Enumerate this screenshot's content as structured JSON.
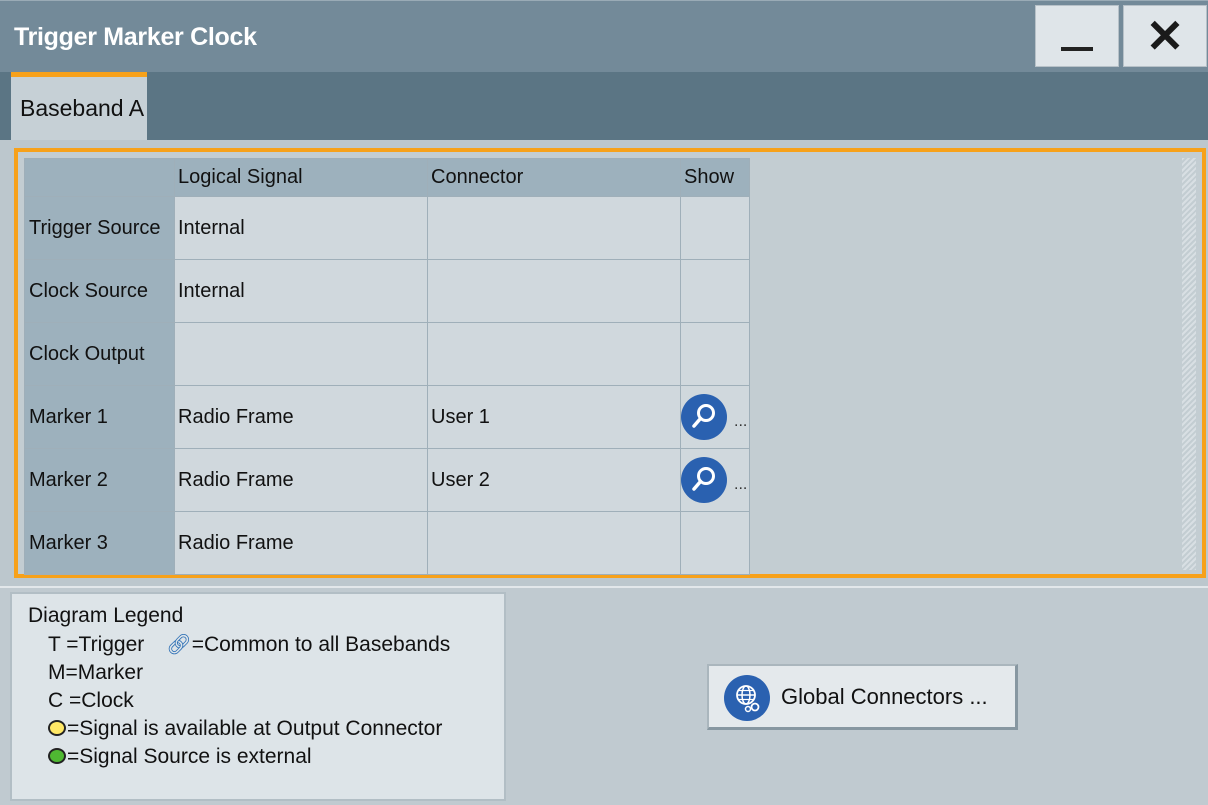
{
  "window": {
    "title": "Trigger Marker Clock",
    "minimize_label": "—",
    "close_label": "✕"
  },
  "tabs": [
    {
      "label": "Baseband A",
      "active": true
    }
  ],
  "table": {
    "headers": [
      "",
      "Logical Signal",
      "Connector",
      "Show"
    ],
    "rows": [
      {
        "label": "Trigger Source",
        "signal": "Internal",
        "connector": "",
        "show": false
      },
      {
        "label": "Clock Source",
        "signal": "Internal",
        "connector": "",
        "show": false
      },
      {
        "label": "Clock Output",
        "signal": "",
        "connector": "",
        "show": false
      },
      {
        "label": "Marker 1",
        "signal": "Radio Frame",
        "connector": "User 1",
        "show": true,
        "show_suffix": "..."
      },
      {
        "label": "Marker 2",
        "signal": "Radio Frame",
        "connector": "User 2",
        "show": true,
        "show_suffix": "..."
      },
      {
        "label": "Marker 3",
        "signal": "Radio Frame",
        "connector": "",
        "show": false
      }
    ]
  },
  "legend": {
    "title": "Diagram Legend",
    "trigger": "T =Trigger",
    "common": "=Common to all Basebands",
    "marker": "M=Marker",
    "clock": "C =Clock",
    "output_available": "=Signal is available at Output Connector",
    "source_external": "=Signal Source is external"
  },
  "global_connectors": {
    "label": "Global Connectors ..."
  },
  "colors": {
    "accent": "#f7a11a",
    "title_bar": "#738a99",
    "button_blue": "#2a61b0"
  }
}
